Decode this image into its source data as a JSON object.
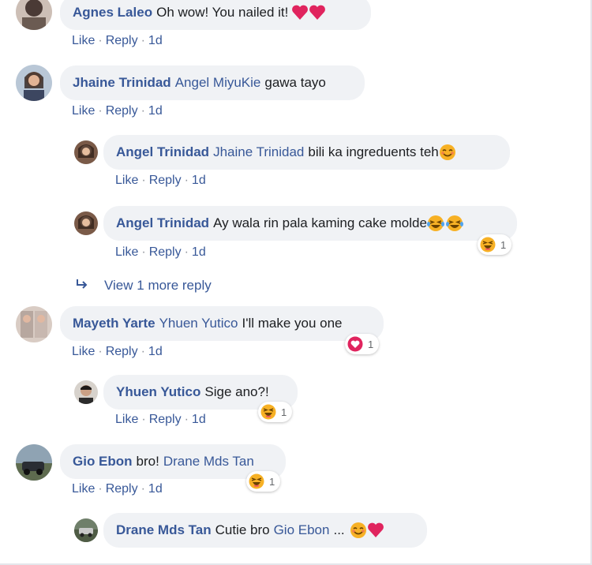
{
  "actions": {
    "like": "Like",
    "reply": "Reply",
    "sep": "·"
  },
  "comments": [
    {
      "author": "Agnes Laleo",
      "text": "Oh wow! You nailed it!",
      "time": "1d"
    },
    {
      "author": "Jhaine Trinidad",
      "mention": "Angel MiyuKie",
      "text": "gawa tayo",
      "time": "1d"
    },
    {
      "author": "Angel Trinidad",
      "mention": "Jhaine Trinidad",
      "text": "bili ka ingreduents teh",
      "time": "1d"
    },
    {
      "author": "Angel Trinidad",
      "text": "Ay wala rin pala kaming cake molde",
      "time": "1d",
      "reaction_count": "1"
    },
    {
      "author": "Mayeth Yarte",
      "mention": "Yhuen Yutico",
      "text": "I'll make you one",
      "time": "1d",
      "reaction_count": "1"
    },
    {
      "author": "Yhuen Yutico",
      "text": "Sige ano?!",
      "time": "1d",
      "reaction_count": "1"
    },
    {
      "author": "Gio Ebon",
      "text": "bro!",
      "mention": "Drane Mds Tan",
      "time": "1d",
      "reaction_count": "1"
    },
    {
      "author": "Drane Mds Tan",
      "text": "Cutie bro",
      "mention": "Gio Ebon",
      "ellipsis": "..."
    }
  ],
  "view_more": "View 1 more reply",
  "colors": {
    "link": "#385898",
    "bubble": "#f0f2f5",
    "heart": "#e0245e",
    "haha": "#f7b125"
  },
  "icons": [
    "heart-icon",
    "laughing-crying-icon",
    "haha-reaction-icon",
    "love-reaction-icon",
    "blush-icon",
    "reply-arrow-icon"
  ]
}
